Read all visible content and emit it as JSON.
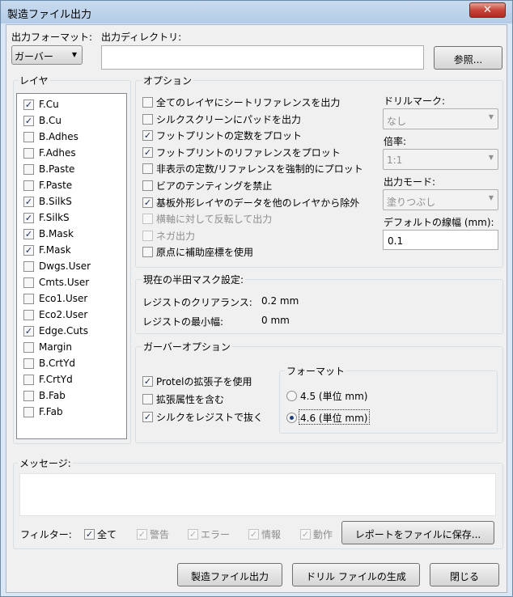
{
  "window": {
    "title": "製造ファイル出力",
    "close": "✕"
  },
  "output": {
    "format_label": "出力フォーマット:",
    "format_value": "ガーバー",
    "dir_label": "出力ディレクトリ:",
    "dir_value": "",
    "browse_label": "参照..."
  },
  "layers": {
    "title": "レイヤ",
    "items": [
      {
        "label": "F.Cu",
        "checked": true
      },
      {
        "label": "B.Cu",
        "checked": true
      },
      {
        "label": "B.Adhes",
        "checked": false
      },
      {
        "label": "F.Adhes",
        "checked": false
      },
      {
        "label": "B.Paste",
        "checked": false
      },
      {
        "label": "F.Paste",
        "checked": false
      },
      {
        "label": "B.SilkS",
        "checked": true
      },
      {
        "label": "F.SilkS",
        "checked": true
      },
      {
        "label": "B.Mask",
        "checked": true
      },
      {
        "label": "F.Mask",
        "checked": true
      },
      {
        "label": "Dwgs.User",
        "checked": false
      },
      {
        "label": "Cmts.User",
        "checked": false
      },
      {
        "label": "Eco1.User",
        "checked": false
      },
      {
        "label": "Eco2.User",
        "checked": false
      },
      {
        "label": "Edge.Cuts",
        "checked": true
      },
      {
        "label": "Margin",
        "checked": false
      },
      {
        "label": "B.CrtYd",
        "checked": false
      },
      {
        "label": "F.CrtYd",
        "checked": false
      },
      {
        "label": "B.Fab",
        "checked": false
      },
      {
        "label": "F.Fab",
        "checked": false
      }
    ]
  },
  "options": {
    "title": "オプション",
    "items": [
      {
        "label": "全てのレイヤにシートリファレンスを出力",
        "checked": false,
        "enabled": true
      },
      {
        "label": "シルクスクリーンにパッドを出力",
        "checked": false,
        "enabled": true
      },
      {
        "label": "フットプリントの定数をプロット",
        "checked": true,
        "enabled": true
      },
      {
        "label": "フットプリントのリファレンスをプロット",
        "checked": true,
        "enabled": true
      },
      {
        "label": "非表示の定数/リファレンスを強制的にプロット",
        "checked": false,
        "enabled": true
      },
      {
        "label": "ビアのテンティングを禁止",
        "checked": false,
        "enabled": true
      },
      {
        "label": "基板外形レイヤのデータを他のレイヤから除外",
        "checked": true,
        "enabled": true
      },
      {
        "label": "横軸に対して反転して出力",
        "checked": false,
        "enabled": false
      },
      {
        "label": "ネガ出力",
        "checked": false,
        "enabled": false
      },
      {
        "label": "原点に補助座標を使用",
        "checked": false,
        "enabled": true
      }
    ],
    "drill_marks_label": "ドリルマーク:",
    "drill_marks_value": "なし",
    "scale_label": "倍率:",
    "scale_value": "1:1",
    "plot_mode_label": "出力モード:",
    "plot_mode_value": "塗りつぶし",
    "line_width_label": "デフォルトの線幅 (mm):",
    "line_width_value": "0.1"
  },
  "solder_mask": {
    "title": "現在の半田マスク設定:",
    "clearance_label": "レジストのクリアランス:",
    "clearance_value": "0.2 mm",
    "min_width_label": "レジストの最小幅:",
    "min_width_value": "0 mm"
  },
  "gerber": {
    "title": "ガーバーオプション",
    "items": [
      {
        "label": "Protelの拡張子を使用",
        "checked": true
      },
      {
        "label": "拡張属性を含む",
        "checked": false
      },
      {
        "label": "シルクをレジストで抜く",
        "checked": true
      }
    ],
    "format_title": "フォーマット",
    "format_options": [
      {
        "label": "4.5 (単位 mm)",
        "selected": false
      },
      {
        "label": "4.6 (単位 mm)",
        "selected": true
      }
    ]
  },
  "messages": {
    "title": "メッセージ:",
    "filter_label": "フィルター:",
    "filters": [
      {
        "label": "全て",
        "checked": true,
        "enabled": true
      },
      {
        "label": "警告",
        "checked": true,
        "enabled": false
      },
      {
        "label": "エラー",
        "checked": true,
        "enabled": false
      },
      {
        "label": "情報",
        "checked": true,
        "enabled": false
      },
      {
        "label": "動作",
        "checked": true,
        "enabled": false
      }
    ],
    "save_report_label": "レポートをファイルに保存..."
  },
  "footer": {
    "plot_label": "製造ファイル出力",
    "drill_label": "ドリル ファイルの生成",
    "close_label": "閉じる"
  }
}
